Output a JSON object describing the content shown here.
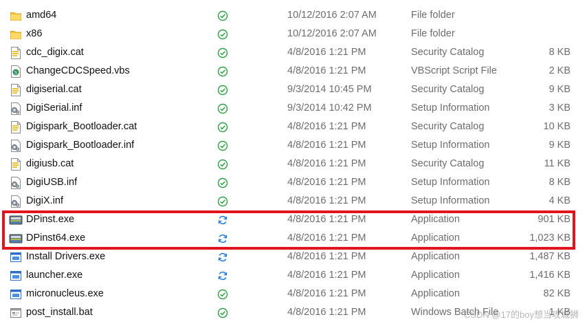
{
  "files": [
    {
      "name": "amd64",
      "icon": "folder-icon",
      "status": "synced-check-icon",
      "date": "10/12/2016 2:07 AM",
      "type": "File folder",
      "size": ""
    },
    {
      "name": "x86",
      "icon": "folder-icon",
      "status": "synced-check-icon",
      "date": "10/12/2016 2:07 AM",
      "type": "File folder",
      "size": ""
    },
    {
      "name": "cdc_digix.cat",
      "icon": "catalog-file-icon",
      "status": "synced-check-icon",
      "date": "4/8/2016 1:21 PM",
      "type": "Security Catalog",
      "size": "8 KB"
    },
    {
      "name": "ChangeCDCSpeed.vbs",
      "icon": "vbscript-file-icon",
      "status": "synced-check-icon",
      "date": "4/8/2016 1:21 PM",
      "type": "VBScript Script File",
      "size": "2 KB"
    },
    {
      "name": "digiserial.cat",
      "icon": "catalog-file-icon",
      "status": "synced-check-icon",
      "date": "9/3/2014 10:45 PM",
      "type": "Security Catalog",
      "size": "9 KB"
    },
    {
      "name": "DigiSerial.inf",
      "icon": "setup-info-file-icon",
      "status": "synced-check-icon",
      "date": "9/3/2014 10:42 PM",
      "type": "Setup Information",
      "size": "3 KB"
    },
    {
      "name": "Digispark_Bootloader.cat",
      "icon": "catalog-file-icon",
      "status": "synced-check-icon",
      "date": "4/8/2016 1:21 PM",
      "type": "Security Catalog",
      "size": "10 KB"
    },
    {
      "name": "Digispark_Bootloader.inf",
      "icon": "setup-info-file-icon",
      "status": "synced-check-icon",
      "date": "4/8/2016 1:21 PM",
      "type": "Setup Information",
      "size": "9 KB"
    },
    {
      "name": "digiusb.cat",
      "icon": "catalog-file-icon",
      "status": "synced-check-icon",
      "date": "4/8/2016 1:21 PM",
      "type": "Security Catalog",
      "size": "11 KB"
    },
    {
      "name": "DigiUSB.inf",
      "icon": "setup-info-file-icon",
      "status": "synced-check-icon",
      "date": "4/8/2016 1:21 PM",
      "type": "Setup Information",
      "size": "8 KB"
    },
    {
      "name": "DigiX.inf",
      "icon": "setup-info-file-icon",
      "status": "synced-check-icon",
      "date": "4/8/2016 1:21 PM",
      "type": "Setup Information",
      "size": "4 KB"
    },
    {
      "name": "DPinst.exe",
      "icon": "installer-exe-icon",
      "status": "sync-pending-icon",
      "date": "4/8/2016 1:21 PM",
      "type": "Application",
      "size": "901 KB"
    },
    {
      "name": "DPinst64.exe",
      "icon": "installer-exe-icon",
      "status": "sync-pending-icon",
      "date": "4/8/2016 1:21 PM",
      "type": "Application",
      "size": "1,023 KB"
    },
    {
      "name": "Install Drivers.exe",
      "icon": "app-window-icon",
      "status": "sync-pending-icon",
      "date": "4/8/2016 1:21 PM",
      "type": "Application",
      "size": "1,487 KB"
    },
    {
      "name": "launcher.exe",
      "icon": "app-window-icon",
      "status": "sync-pending-icon",
      "date": "4/8/2016 1:21 PM",
      "type": "Application",
      "size": "1,416 KB"
    },
    {
      "name": "micronucleus.exe",
      "icon": "app-window-icon",
      "status": "synced-check-icon",
      "date": "4/8/2016 1:21 PM",
      "type": "Application",
      "size": "82 KB"
    },
    {
      "name": "post_install.bat",
      "icon": "batch-file-icon",
      "status": "synced-check-icon",
      "date": "4/8/2016 1:21 PM",
      "type": "Windows Batch File",
      "size": "1 KB"
    }
  ],
  "watermark": "CSDN @17的boy想当攻城狮",
  "colors": {
    "highlight": "#e0141e",
    "synced": "#2e9e44",
    "pending": "#1f7ad6"
  }
}
